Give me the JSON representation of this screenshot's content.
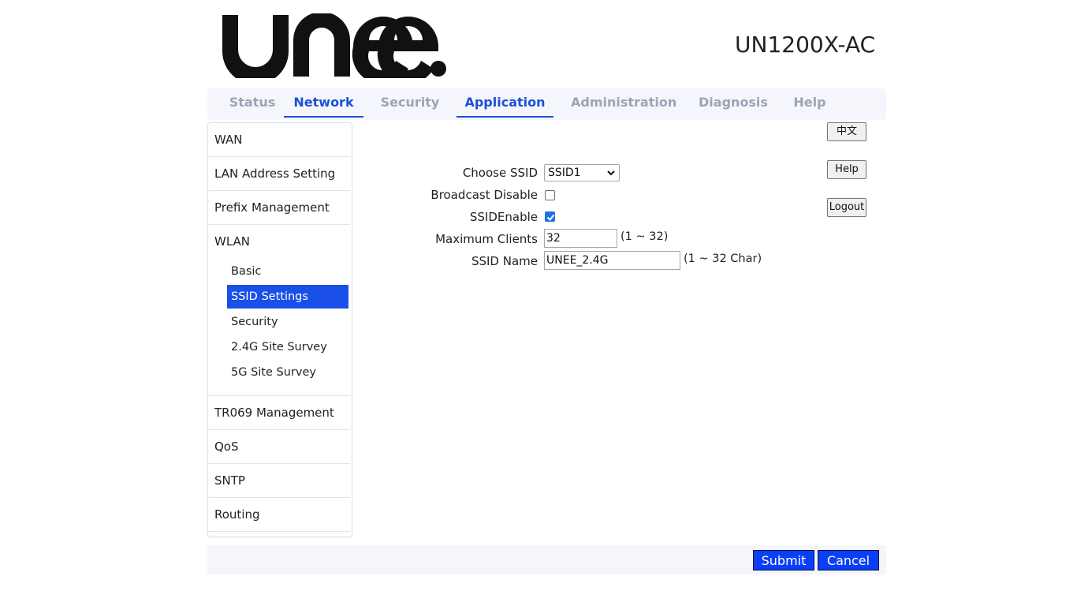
{
  "brand": {
    "logo_text": "UNEE",
    "model": "UN1200X-AC"
  },
  "topnav": {
    "tabs": [
      {
        "label": "Status",
        "active": false
      },
      {
        "label": "Network",
        "active": true
      },
      {
        "label": "Security",
        "active": false
      },
      {
        "label": "Application",
        "active": true
      },
      {
        "label": "Administration",
        "active": false
      },
      {
        "label": "Diagnosis",
        "active": false
      },
      {
        "label": "Help",
        "active": false
      }
    ]
  },
  "sidebar": {
    "items": [
      "WAN",
      "LAN Address Setting",
      "Prefix Management"
    ],
    "wlan": {
      "label": "WLAN",
      "sub": [
        "Basic",
        "SSID Settings",
        "Security",
        "2.4G Site Survey",
        "5G Site Survey"
      ],
      "active_sub": "SSID Settings"
    },
    "items_after": [
      "TR069 Management",
      "QoS",
      "SNTP",
      "Routing"
    ]
  },
  "side_buttons": {
    "language": "中文",
    "help": "Help",
    "logout": "Logout"
  },
  "form": {
    "choose_ssid_label": "Choose SSID",
    "choose_ssid_value": "SSID1",
    "broadcast_disable_label": "Broadcast Disable",
    "broadcast_disable_checked": false,
    "ssid_enable_label": "SSIDEnable",
    "ssid_enable_checked": true,
    "max_clients_label": "Maximum Clients",
    "max_clients_value": "32",
    "max_clients_hint": "(1 ~ 32)",
    "ssid_name_label": "SSID Name",
    "ssid_name_value": "UNEE_2.4G",
    "ssid_name_hint": "(1 ~ 32 Char)"
  },
  "footer": {
    "submit": "Submit",
    "cancel": "Cancel"
  },
  "colors": {
    "accent": "#1e4fd8",
    "active_bg": "#1a4fe8",
    "button_blue": "#0b3ff7",
    "nav_bg": "#f4f6fb"
  }
}
